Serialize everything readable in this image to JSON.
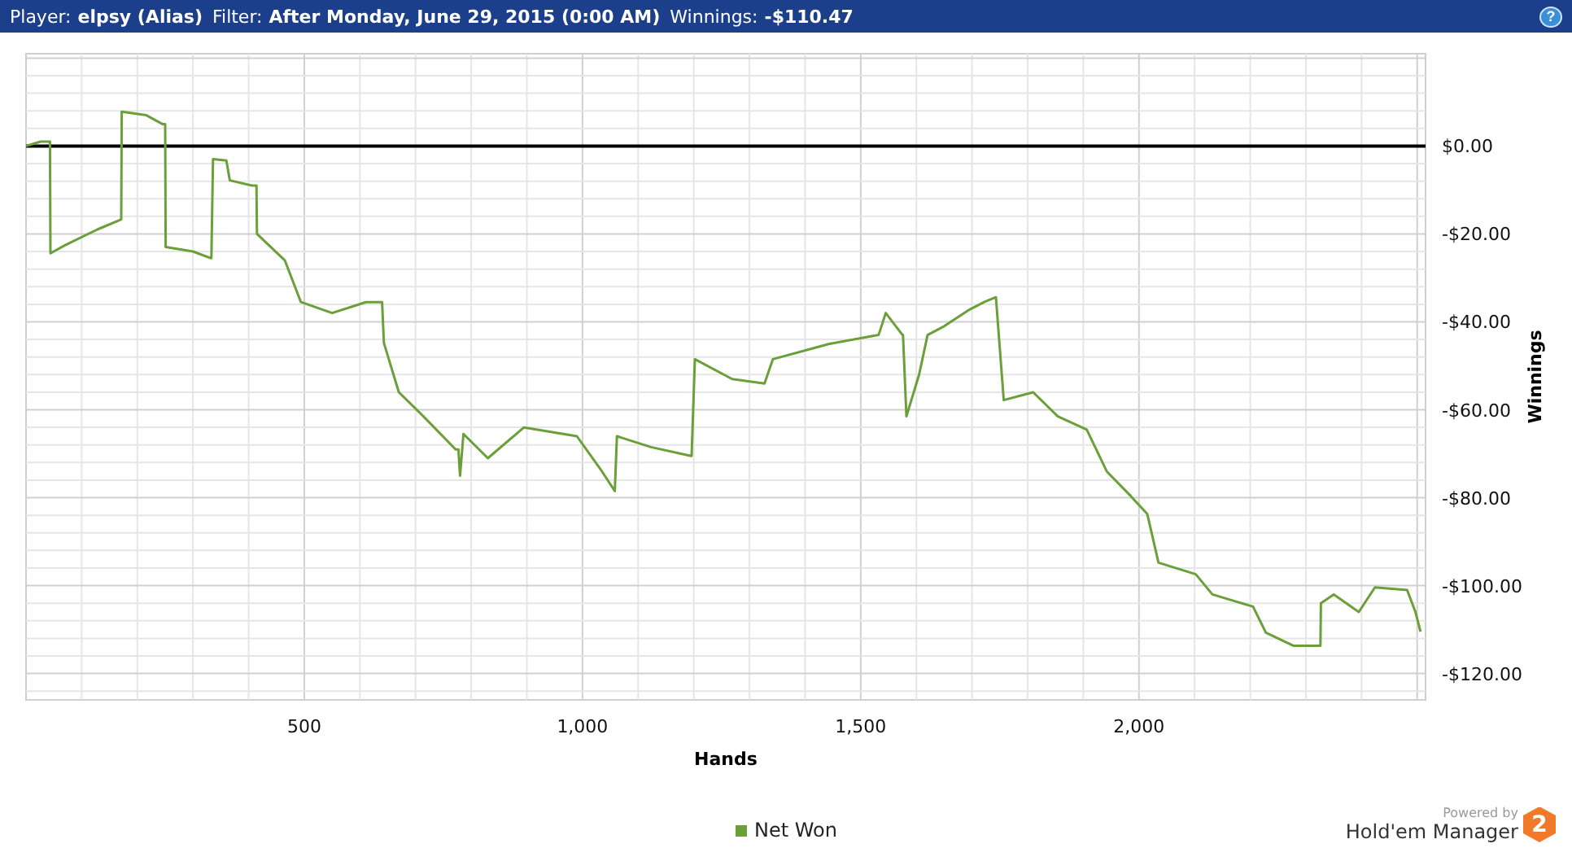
{
  "header": {
    "player_label": "Player:",
    "player": "elpsy (Alias)",
    "filter_label": "Filter:",
    "filter": "After Monday, June 29, 2015 (0:00 AM)",
    "winnings_label": "Winnings:",
    "winnings": "-$110.47",
    "help": "?"
  },
  "chart": {
    "chart_data": {
      "type": "line",
      "grid": true,
      "xlabel": "Hands",
      "ylabel": "Winnings",
      "xlim": [
        0,
        2515
      ],
      "ylim": [
        -126,
        21
      ],
      "xticks": [
        {
          "value": 500,
          "label": "500"
        },
        {
          "value": 1000,
          "label": "1,000"
        },
        {
          "value": 1500,
          "label": "1,500"
        },
        {
          "value": 2000,
          "label": "2,000"
        }
      ],
      "yticks": [
        {
          "value": 0,
          "label": "$0.00"
        },
        {
          "value": -20,
          "label": "-$20.00"
        },
        {
          "value": -40,
          "label": "-$40.00"
        },
        {
          "value": -60,
          "label": "-$60.00"
        },
        {
          "value": -80,
          "label": "-$80.00"
        },
        {
          "value": -100,
          "label": "-$100.00"
        },
        {
          "value": -120,
          "label": "-$120.00"
        }
      ],
      "x": [
        0,
        26,
        43,
        44,
        70,
        128,
        171,
        172,
        216,
        245,
        250,
        251,
        300,
        332,
        333,
        336,
        360,
        366,
        406,
        414,
        415,
        465,
        494,
        550,
        611,
        640,
        643,
        670,
        714,
        772,
        777,
        780,
        786,
        830,
        895,
        990,
        1035,
        1058,
        1062,
        1123,
        1195,
        1196,
        1202,
        1269,
        1327,
        1342,
        1444,
        1532,
        1545,
        1575,
        1576,
        1582,
        1605,
        1620,
        1650,
        1693,
        1722,
        1743,
        1757,
        1810,
        1854,
        1906,
        1942,
        1985,
        2015,
        2035,
        2102,
        2132,
        2205,
        2228,
        2278,
        2326,
        2327,
        2350,
        2395,
        2424,
        2482,
        2497,
        2506
      ],
      "series": [
        {
          "name": "Net Won",
          "color": "#6a9f3a",
          "values": [
            0,
            1,
            1,
            -24.4,
            -22.6,
            -19,
            -16.7,
            7.8,
            7,
            5,
            5,
            -23,
            -24,
            -25.5,
            -25.5,
            -3,
            -3.3,
            -7.8,
            -9,
            -9,
            -20,
            -26,
            -35.5,
            -38,
            -35.5,
            -35.5,
            -44.8,
            -56,
            -61.5,
            -69,
            -69,
            -75,
            -65.5,
            -71,
            -64,
            -66,
            -74,
            -78.5,
            -66,
            -68.5,
            -70.5,
            -70.5,
            -48.5,
            -53,
            -54,
            -48.5,
            -45,
            -43,
            -38,
            -43,
            -43,
            -61.5,
            -52,
            -43,
            -41,
            -37.4,
            -35.5,
            -34.4,
            -57.8,
            -56,
            -61.5,
            -64.5,
            -74,
            -79.6,
            -83.7,
            -94.8,
            -97.4,
            -102,
            -104.8,
            -110.7,
            -113.7,
            -113.7,
            -104,
            -102,
            -106,
            -100.4,
            -101,
            -106,
            -110.5
          ]
        }
      ]
    }
  },
  "branding": {
    "powered_by": "Powered by",
    "product": "Hold'em Manager",
    "badge": "2"
  }
}
